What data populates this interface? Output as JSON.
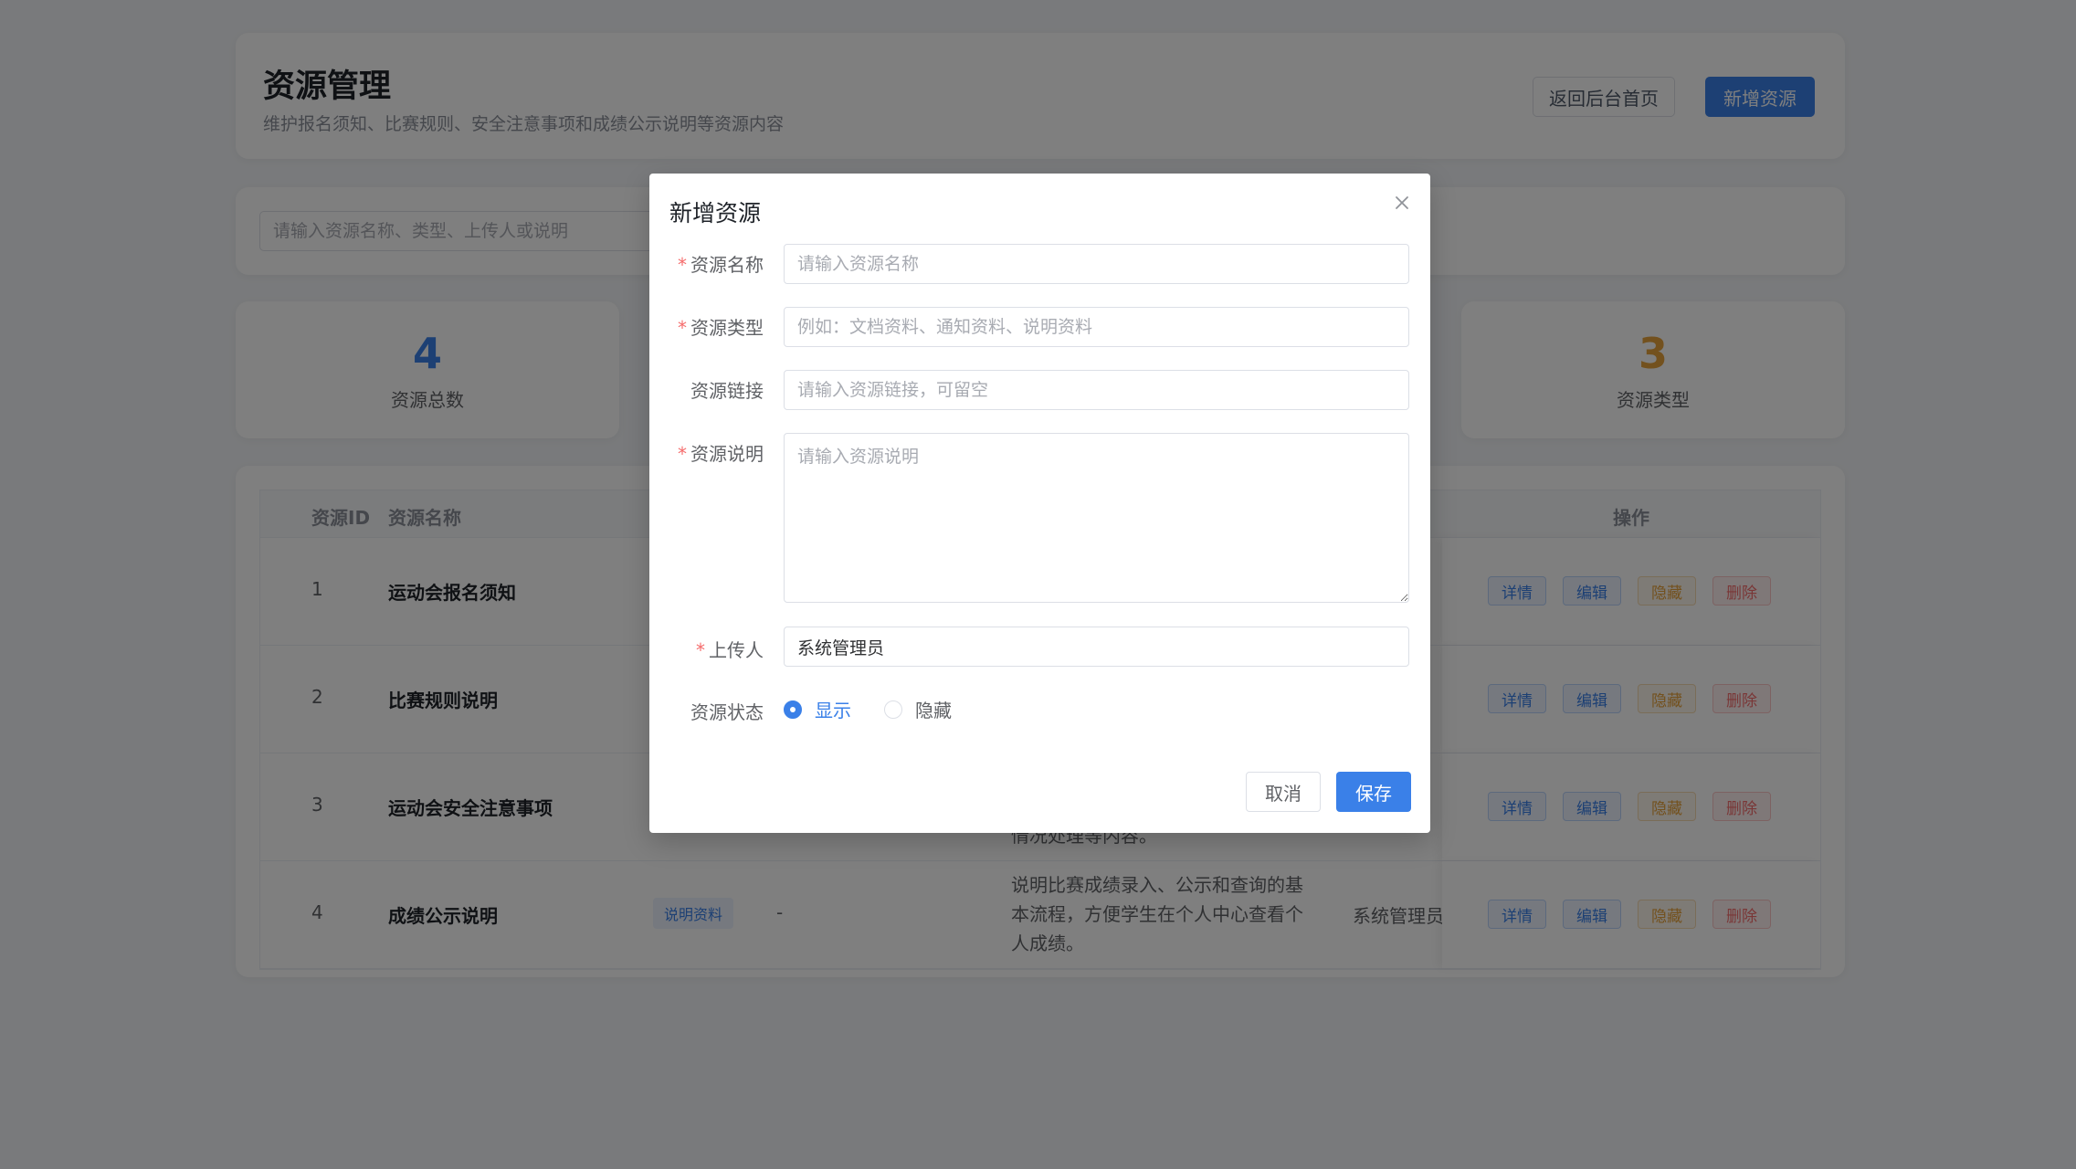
{
  "header": {
    "title": "资源管理",
    "subtitle": "维护报名须知、比赛规则、安全注意事项和成绩公示说明等资源内容",
    "back_label": "返回后台首页",
    "add_label": "新增资源"
  },
  "search": {
    "placeholder": "请输入资源名称、类型、上传人或说明"
  },
  "stats": [
    {
      "value": "4",
      "label": "资源总数",
      "color": "#3a80e8"
    },
    {
      "value": "3",
      "label": "资源类型",
      "color": "#e6a23c"
    }
  ],
  "table": {
    "columns": {
      "id": "资源ID",
      "name": "资源名称",
      "ops": "操作"
    },
    "rows": [
      {
        "id": "1",
        "name": "运动会报名须知",
        "type": "",
        "link": "",
        "desc": "",
        "uploader": ""
      },
      {
        "id": "2",
        "name": "比赛规则说明",
        "type": "",
        "link": "",
        "desc": "",
        "uploader": ""
      },
      {
        "id": "3",
        "name": "运动会安全注意事项",
        "type": "",
        "link": "",
        "desc": "情况处理等内容。",
        "uploader": ""
      },
      {
        "id": "4",
        "name": "成绩公示说明",
        "type": "说明资料",
        "link": "-",
        "desc": "说明比赛成绩录入、公示和查询的基本流程，方便学生在个人中心查看个人成绩。",
        "uploader": "系统管理员"
      }
    ],
    "ops": {
      "detail": "详情",
      "edit": "编辑",
      "hide": "隐藏",
      "delete": "删除"
    }
  },
  "dialog": {
    "title": "新增资源",
    "fields": {
      "name": {
        "label": "资源名称",
        "placeholder": "请输入资源名称"
      },
      "type": {
        "label": "资源类型",
        "placeholder": "例如：文档资料、通知资料、说明资料"
      },
      "link": {
        "label": "资源链接",
        "placeholder": "请输入资源链接，可留空"
      },
      "desc": {
        "label": "资源说明",
        "placeholder": "请输入资源说明"
      },
      "uploader": {
        "label": "上传人",
        "value": "系统管理员"
      },
      "status": {
        "label": "资源状态",
        "option_show": "显示",
        "option_hide": "隐藏",
        "selected": "显示"
      }
    },
    "required_mark": "*",
    "cancel_label": "取消",
    "save_label": "保存"
  }
}
